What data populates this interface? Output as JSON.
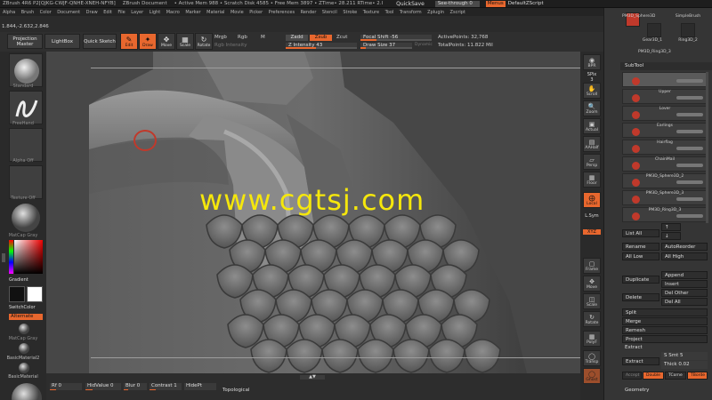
{
  "titlebar": {
    "app": "ZBrush 4R6 P2[QJKG-CWJF-QNHE-XNEH-NFYB]",
    "document": "ZBrush Document",
    "mem_stats": "• Active Mem 988 • Scratch Disk 4585 • Free Mem 3897 • ZTime• 28.211 RTime• 2.I",
    "quicksave": "QuickSave",
    "seethrough_label": "See-through",
    "seethrough_value": "0",
    "menus": "Menus",
    "zscript": "DefaultZScript"
  },
  "menubar": [
    "Alpha",
    "Brush",
    "Color",
    "Document",
    "Draw",
    "Edit",
    "File",
    "Layer",
    "Light",
    "Macro",
    "Marker",
    "Material",
    "Movie",
    "Picker",
    "Preferences",
    "Render",
    "Stencil",
    "Stroke",
    "Texture",
    "Tool",
    "Transform",
    "Zplugin",
    "Zscript"
  ],
  "coords": "1.844,-2.632,2.846",
  "toolbar": {
    "projection_master": "Projection Master",
    "lightbox": "LightBox",
    "quick_sketch": "Quick Sketch",
    "edit": "Edit",
    "draw": "Draw",
    "move": "Move",
    "scale": "Scale",
    "rotate": "Rotate",
    "mrgb": "Mrgb",
    "rgb": "Rgb",
    "m": "M",
    "rgb_intensity": "Rgb Intensity",
    "zadd": "Zadd",
    "zsub": "Zsub",
    "zcut": "Zcut",
    "z_intensity": "Z Intensity 43",
    "focal_shift": "Focal Shift -56",
    "draw_size": "Draw Size 37",
    "dynamic": "Dynamic",
    "active_points": "ActivePoints: 32,768",
    "total_points": "TotalPoints: 11.822 Mil"
  },
  "leftshelf": {
    "standard": "Standard",
    "freehand": "FreeHand",
    "alpha_off": "Alpha Off",
    "texture_off": "Texture Off",
    "matcap": "MatCap Gray",
    "gradient": "Gradient",
    "switchcolor": "SwitchColor",
    "alternate": "Alternate",
    "matcap2": "MatCap Gray",
    "basicmaterial2": "BasicMaterial2",
    "basicmaterial": "BasicMaterial"
  },
  "watermark": "www.cgtsj.com",
  "bottombar": {
    "rf": "Rf 0",
    "hidevalue": "HidValue 0",
    "blur": "Blur 0",
    "contrast": "Contrast 1",
    "hidept": "HidePt",
    "topological": "Topological"
  },
  "rightshelf": {
    "bpr": "BPR",
    "spix": "SPix",
    "spix_value": "3",
    "scroll": "Scroll",
    "zoom": "Zoom",
    "actual": "Actual",
    "aahalf": "AAHalf",
    "persp": "Persp",
    "floor": "Floor",
    "local": "Local",
    "lsym": "L.Sym",
    "xyz": "XYZ",
    "frame": "Frame",
    "move": "Move",
    "scale": "Scale",
    "rotate": "Rotate",
    "polyf": "PolyF",
    "transp": "Transp",
    "ghost": "Ghost"
  },
  "rightpanel": {
    "tools": [
      {
        "name": "PM3D_Sphere3D"
      },
      {
        "name": "SimpleBrush"
      },
      {
        "name": "Gear3D_1"
      },
      {
        "name": "Ring3D_2"
      },
      {
        "name": "PM3D_Ring3D_3"
      }
    ],
    "subtool_header": "SubTool",
    "subtools": [
      "",
      "Upper",
      "Lover",
      "Earlings",
      "Hairflag",
      "ChainMail",
      "PM3D_Sphere3D_2",
      "PM3D_Sphere3D_3",
      "PM3D_Ring3D_3"
    ],
    "list_all": "List All",
    "rename": "Rename",
    "auto_reorder": "AutoReorder",
    "all_low": "All Low",
    "all_high": "All High",
    "duplicate": "Duplicate",
    "append": "Append",
    "insert": "Insert",
    "delete": "Delete",
    "del_other": "Del Other",
    "del_all": "Del All",
    "split": "Split",
    "merge": "Merge",
    "remesh": "Remesh",
    "project": "Project",
    "extract_header": "Extract",
    "extract": "Extract",
    "s_smt": "S Smt 5",
    "thick": "Thick 0.02",
    "accept": "Accept",
    "double": "Double",
    "tcorner": "TCorne",
    "tborder": "TBorde",
    "geometry": "Geometry"
  }
}
